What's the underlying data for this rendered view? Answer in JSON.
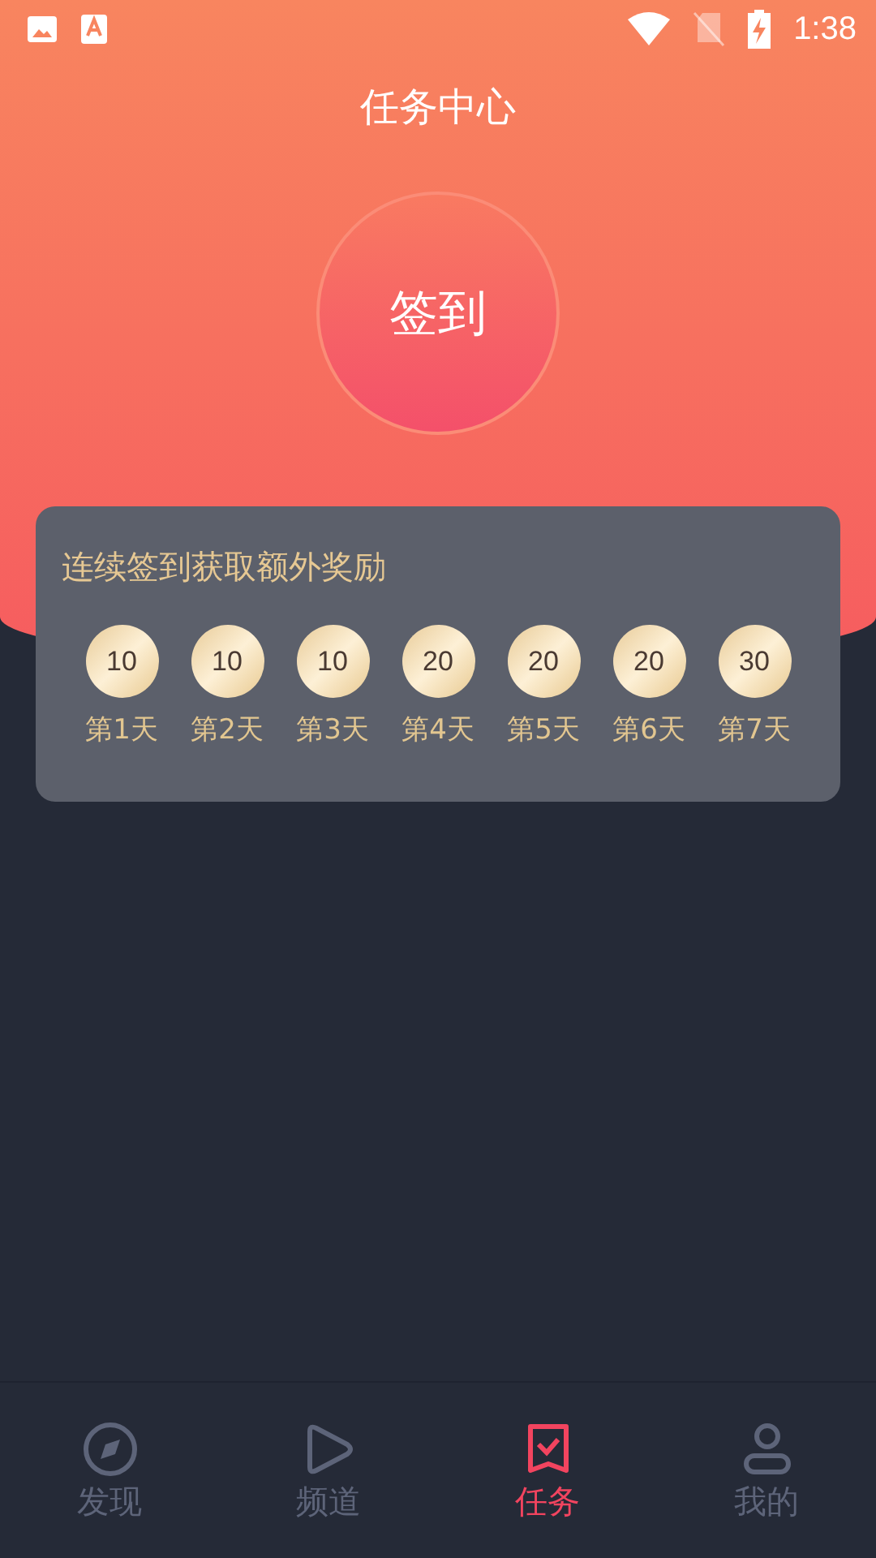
{
  "status_bar": {
    "time": "1:38"
  },
  "title": "任务中心",
  "sign_in_button": "签到",
  "streak_card": {
    "title": "连续签到获取额外奖励",
    "days": [
      {
        "points": "10",
        "label": "第1天"
      },
      {
        "points": "10",
        "label": "第2天"
      },
      {
        "points": "10",
        "label": "第3天"
      },
      {
        "points": "20",
        "label": "第4天"
      },
      {
        "points": "20",
        "label": "第5天"
      },
      {
        "points": "20",
        "label": "第6天"
      },
      {
        "points": "30",
        "label": "第7天"
      }
    ]
  },
  "tab_bar": [
    {
      "kind": "compass",
      "label": "发现",
      "selected": false
    },
    {
      "kind": "play",
      "label": "频道",
      "selected": false
    },
    {
      "kind": "task",
      "label": "任务",
      "selected": true
    },
    {
      "kind": "user",
      "label": "我的",
      "selected": false
    }
  ]
}
